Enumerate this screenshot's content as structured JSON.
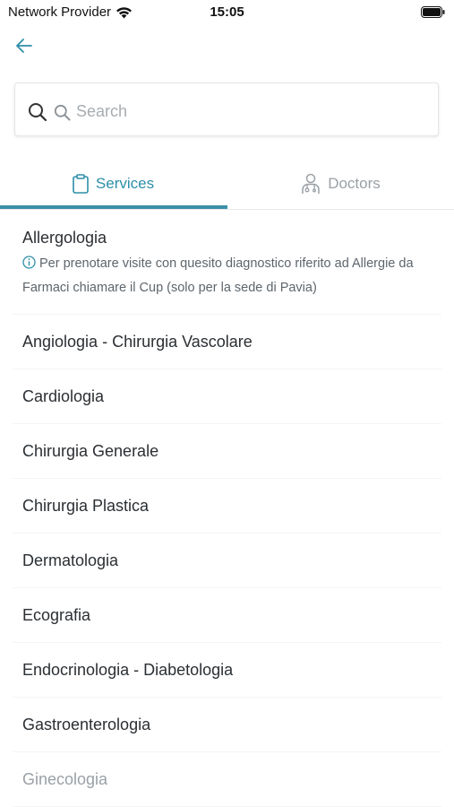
{
  "status_bar": {
    "carrier": "Network Provider",
    "time": "15:05"
  },
  "search": {
    "placeholder": "Search",
    "value": ""
  },
  "tabs": [
    {
      "label": "Services",
      "icon": "clipboard-icon",
      "active": true
    },
    {
      "label": "Doctors",
      "icon": "doctor-icon",
      "active": false
    }
  ],
  "services": [
    {
      "name": "Allergologia",
      "note": "Per prenotare visite con quesito diagnostico riferito ad Allergie da Farmaci chiamare il Cup (solo per la sede di Pavia)"
    },
    {
      "name": "Angiologia - Chirurgia Vascolare"
    },
    {
      "name": "Cardiologia"
    },
    {
      "name": "Chirurgia Generale"
    },
    {
      "name": "Chirurgia Plastica"
    },
    {
      "name": "Dermatologia"
    },
    {
      "name": "Ecografia"
    },
    {
      "name": "Endocrinologia - Diabetologia"
    },
    {
      "name": "Gastroenterologia"
    },
    {
      "name": "Ginecologia"
    }
  ],
  "colors": {
    "accent": "#2e8fa8",
    "inactive_tab": "#9aa0a5",
    "text": "#2b2f33",
    "note_text": "#5d656c"
  }
}
